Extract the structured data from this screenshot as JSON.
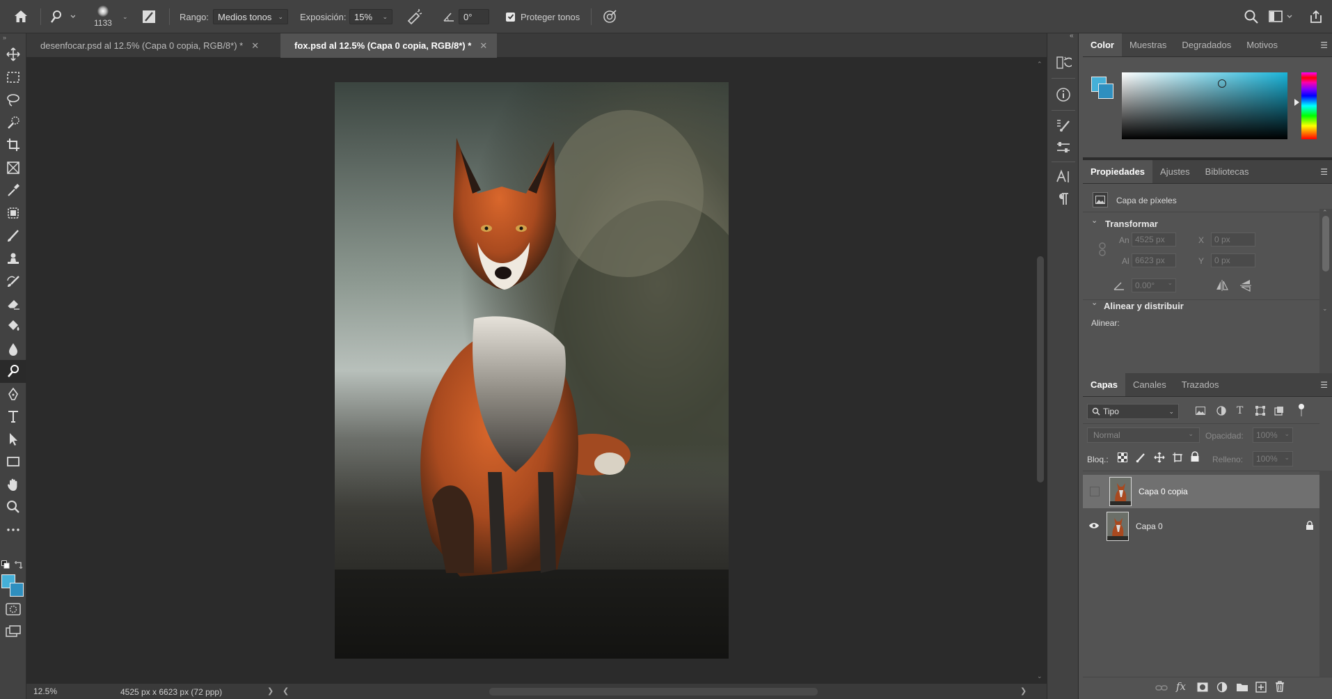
{
  "options_bar": {
    "brush_size": "1133",
    "range_label": "Rango:",
    "range_value": "Medios tonos",
    "exposure_label": "Exposición:",
    "exposure_value": "15%",
    "angle_value": "0°",
    "protect_tones_label": "Proteger tonos",
    "protect_tones_checked": true
  },
  "tabs": [
    {
      "label": "desenfocar.psd al 12.5% (Capa 0 copia, RGB/8*) *",
      "active": false
    },
    {
      "label": "fox.psd al 12.5% (Capa 0 copia, RGB/8*) *",
      "active": true
    }
  ],
  "toolbar": {
    "tools": [
      "move-tool",
      "marquee-tool",
      "lasso-tool",
      "quick-selection-tool",
      "crop-tool",
      "frame-tool",
      "eyedropper-tool",
      "patch-tool",
      "brush-tool",
      "stamp-tool",
      "history-brush-tool",
      "eraser-tool",
      "paint-bucket-tool",
      "blur-tool",
      "dodge-tool",
      "pen-tool",
      "type-tool",
      "path-selection-tool",
      "rectangle-tool",
      "hand-tool",
      "zoom-tool",
      "more-tools"
    ],
    "active_tool": "dodge-tool",
    "foreground_color": "#45b0d8",
    "background_color": "#2f8fbf"
  },
  "status": {
    "zoom": "12.5%",
    "document_dims": "4525 px x 6623 px (72 ppp)"
  },
  "color_panel": {
    "tabs": [
      "Color",
      "Muestras",
      "Degradados",
      "Motivos"
    ],
    "active_tab": "Color",
    "hue_color": "#1ab4d9"
  },
  "properties_panel": {
    "tabs": [
      "Propiedades",
      "Ajustes",
      "Bibliotecas"
    ],
    "active_tab": "Propiedades",
    "layer_type": "Capa de píxeles",
    "transform_section": "Transformar",
    "width_label": "An",
    "width_value": "4525 px",
    "height_label": "Al",
    "height_value": "6623 px",
    "x_label": "X",
    "x_value": "0 px",
    "y_label": "Y",
    "y_value": "0 px",
    "angle_value": "0.00°",
    "align_section": "Alinear y distribuir",
    "align_label": "Alinear:"
  },
  "layers_panel": {
    "tabs": [
      "Capas",
      "Canales",
      "Trazados"
    ],
    "active_tab": "Capas",
    "filter_label": "Tipo",
    "blend_mode": "Normal",
    "opacity_label": "Opacidad:",
    "opacity_value": "100%",
    "lock_label": "Bloq.:",
    "fill_label": "Relleno:",
    "fill_value": "100%",
    "layers": [
      {
        "name": "Capa 0 copia",
        "visible": false,
        "selected": true,
        "locked": false
      },
      {
        "name": "Capa 0",
        "visible": true,
        "selected": false,
        "locked": true
      }
    ]
  }
}
